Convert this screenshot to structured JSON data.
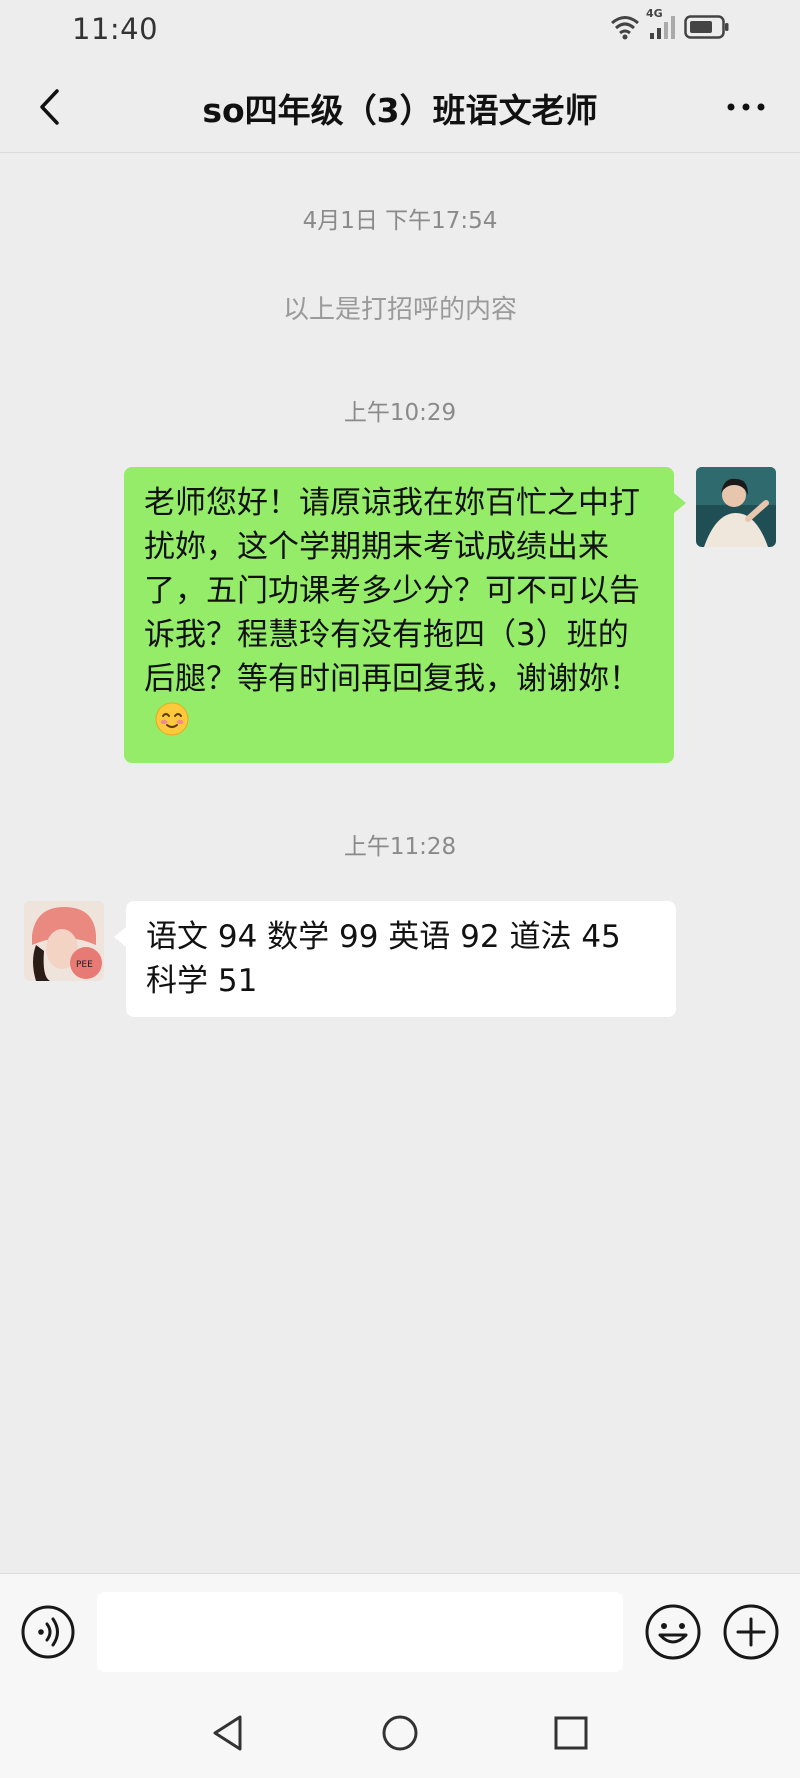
{
  "status_bar": {
    "time": "11:40",
    "network": "4G",
    "icons": [
      "wifi-icon",
      "signal-icon",
      "battery-icon"
    ]
  },
  "header": {
    "title": "so四年级（3）班语文老师",
    "back_icon": "chevron-left-icon",
    "more_icon": "more-dots-icon"
  },
  "chat": {
    "items": [
      {
        "type": "time",
        "text": "4月1日 下午17:54"
      },
      {
        "type": "system",
        "text": "以上是打招呼的内容"
      },
      {
        "type": "time",
        "text": "上午10:29"
      },
      {
        "type": "message",
        "direction": "sent",
        "text": "老师您好！请原谅我在妳百忙之中打扰妳，这个学期期末考试成绩出来了，五门功课考多少分？可不可以告诉我？程慧玲有没有拖四（3）班的后腿？等有时间再回复我，谢谢妳！",
        "emoji": "blushing-smile-emoji"
      },
      {
        "type": "time",
        "text": "上午11:28"
      },
      {
        "type": "message",
        "direction": "received",
        "text": "语文 94 数学 99 英语 92 道法 45 科学 51"
      }
    ]
  },
  "input_bar": {
    "placeholder": "",
    "voice_icon": "voice-icon",
    "emoji_icon": "emoji-icon",
    "plus_icon": "plus-icon"
  },
  "colors": {
    "background": "#EDEDED",
    "sent_bubble": "#95EC69",
    "received_bubble": "#FFFFFF",
    "timestamp_text": "#8A8A8A"
  }
}
